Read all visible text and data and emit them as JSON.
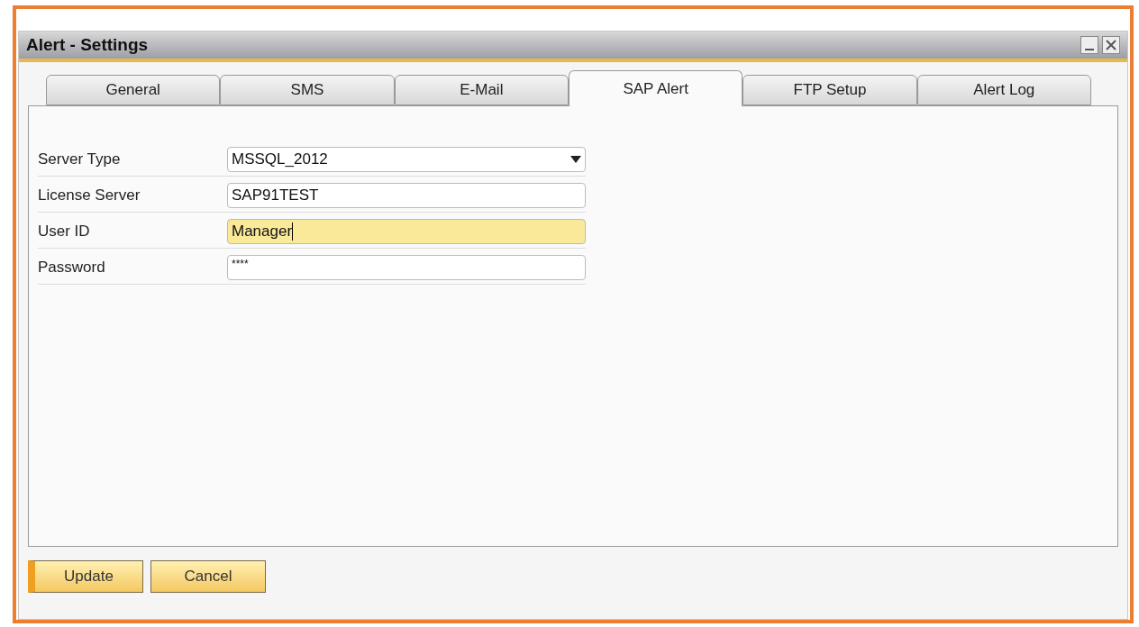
{
  "window": {
    "title": "Alert - Settings"
  },
  "tabs": [
    {
      "label": "General",
      "selected": false
    },
    {
      "label": "SMS",
      "selected": false
    },
    {
      "label": "E-Mail",
      "selected": false
    },
    {
      "label": "SAP Alert",
      "selected": true
    },
    {
      "label": "FTP Setup",
      "selected": false
    },
    {
      "label": "Alert Log",
      "selected": false
    }
  ],
  "fields": [
    {
      "label": "Server Type",
      "kind": "dropdown",
      "value": "MSSQL_2012",
      "focused": false
    },
    {
      "label": "License Server",
      "kind": "text",
      "value": "SAP91TEST",
      "focused": false
    },
    {
      "label": "User ID",
      "kind": "text",
      "value": "Manager",
      "focused": true
    },
    {
      "label": "Password",
      "kind": "password",
      "value": "****",
      "focused": false
    }
  ],
  "buttons": [
    {
      "label": "Update",
      "default": true
    },
    {
      "label": "Cancel",
      "default": false
    }
  ]
}
